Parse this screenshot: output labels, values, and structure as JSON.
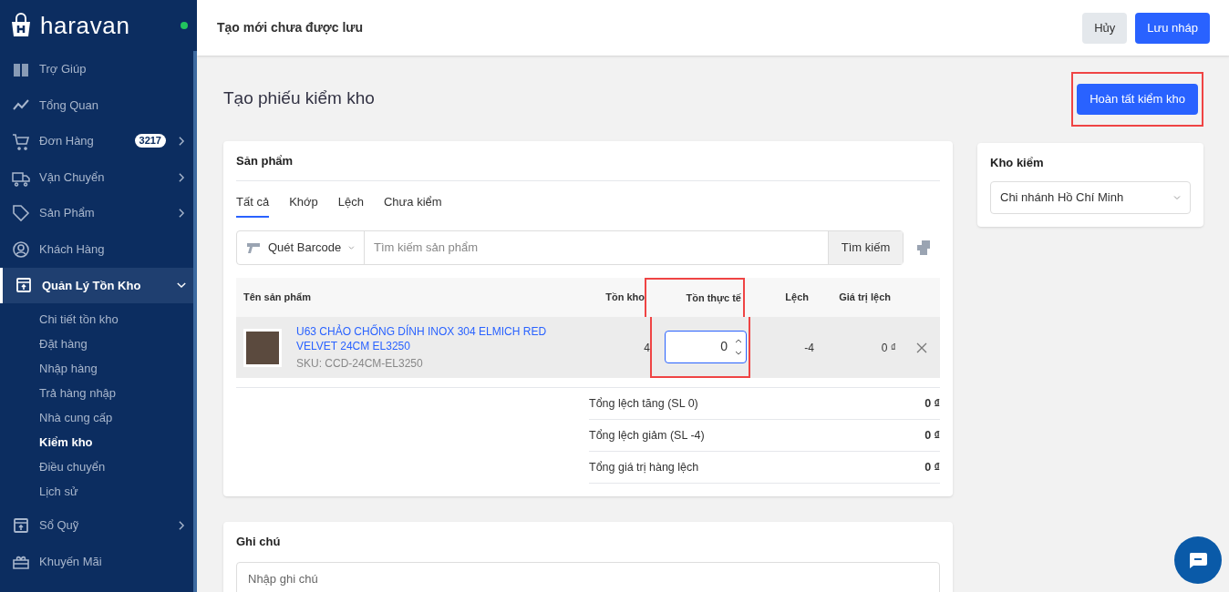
{
  "sidebar": {
    "logo_text": "haravan",
    "online": true,
    "items": [
      {
        "kind": "book",
        "label": "Trợ Giúp",
        "selected": false
      },
      {
        "kind": "chart",
        "label": "Tổng Quan",
        "selected": false
      },
      {
        "kind": "cart",
        "label": "Đơn Hàng",
        "badge": "3217",
        "expanded": false,
        "selected": false
      },
      {
        "kind": "truck",
        "label": "Vận Chuyển",
        "expanded": false,
        "selected": false
      },
      {
        "kind": "tag",
        "label": "Sản Phẩm",
        "expanded": false,
        "selected": false
      },
      {
        "kind": "user",
        "label": "Khách Hàng",
        "selected": false
      },
      {
        "kind": "box",
        "label": "Quản Lý Tồn Kho",
        "expanded": true,
        "selected": true,
        "children": [
          {
            "label": "Chi tiết tồn kho",
            "selected": false
          },
          {
            "label": "Đặt hàng",
            "selected": false
          },
          {
            "label": "Nhập hàng",
            "selected": false
          },
          {
            "label": "Trả hàng nhập",
            "selected": false
          },
          {
            "label": "Nhà cung cấp",
            "selected": false
          },
          {
            "label": "Kiểm kho",
            "selected": true
          },
          {
            "label": "Điều chuyển",
            "selected": false
          },
          {
            "label": "Lịch sử",
            "selected": false
          }
        ]
      },
      {
        "kind": "box",
        "label": "Sổ Quỹ",
        "expanded": false,
        "selected": false
      },
      {
        "kind": "gift",
        "label": "Khuyến Mãi",
        "selected": false
      }
    ]
  },
  "header": {
    "title": "Tạo mới chưa được lưu",
    "buttons": [
      {
        "label": "Hủy",
        "kind": "secondary"
      },
      {
        "label": "Lưu nháp",
        "kind": "primary"
      }
    ]
  },
  "page_title": "Tạo phiếu kiểm kho",
  "complete_button": {
    "label": "Hoàn tất kiểm kho",
    "highlighted": true
  },
  "products": {
    "title": "Sản phẩm",
    "tabs": [
      {
        "label": "Tất cả",
        "selected": true
      },
      {
        "label": "Khớp",
        "selected": false
      },
      {
        "label": "Lệch",
        "selected": false
      },
      {
        "label": "Chưa kiểm",
        "selected": false
      }
    ],
    "scan_mode": "Quét Barcode",
    "search": {
      "placeholder": "Tìm kiếm sản phẩm"
    },
    "search_button": "Tìm kiếm",
    "table": {
      "columns": [
        {
          "label": "Tên sản phẩm",
          "highlighted": false
        },
        {
          "label": "Tồn kho",
          "highlighted": false
        },
        {
          "label": "Tồn thực tế",
          "highlighted": true
        },
        {
          "label": "Lệch",
          "highlighted": false
        },
        {
          "label": "Giá trị lệch",
          "highlighted": false
        }
      ],
      "rows": [
        {
          "name": "U63 CHẢO CHỐNG DÍNH INOX 304 ELMICH RED VELVET 24CM EL3250",
          "sku": "SKU: CCD-24CM-EL3250",
          "on_hand": "4",
          "actual": "0",
          "difference": "-4",
          "difference_value": "0 ₫"
        }
      ]
    },
    "summary": [
      {
        "label": "Tổng lệch tăng (SL 0)",
        "value": "0 ₫"
      },
      {
        "label": "Tổng lệch giảm (SL -4)",
        "value": "0 ₫"
      },
      {
        "label": "Tổng giá trị hàng lệch",
        "value": "0 ₫"
      }
    ]
  },
  "warehouse": {
    "title": "Kho kiểm",
    "value": "Chi nhánh Hồ Chí Minh"
  },
  "notes": {
    "title": "Ghi chú",
    "placeholder": "Nhập ghi chú"
  }
}
